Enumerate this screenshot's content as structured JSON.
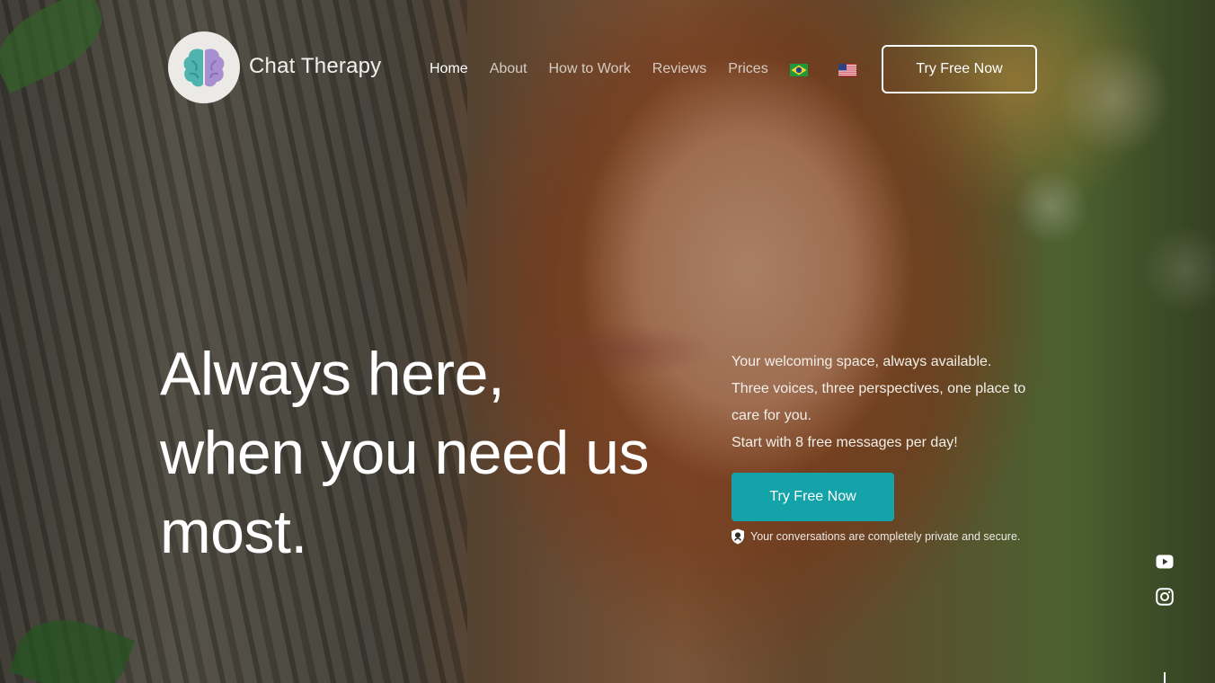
{
  "brand": {
    "name": "Chat Therapy",
    "logo_icon": "brain-icon"
  },
  "nav": {
    "items": [
      {
        "label": "Home",
        "active": true
      },
      {
        "label": "About",
        "active": false
      },
      {
        "label": "How to Work",
        "active": false
      },
      {
        "label": "Reviews",
        "active": false
      },
      {
        "label": "Prices",
        "active": false
      }
    ],
    "languages": [
      "brazil-flag-icon",
      "us-flag-icon"
    ],
    "cta_label": "Try Free Now"
  },
  "hero": {
    "headline_lines": [
      "Always here,",
      "when you need us",
      "most."
    ],
    "intro_lines": [
      "Your welcoming space, always available.",
      "Three voices, three perspectives, one place to care for you.",
      "Start with 8 free messages per day!"
    ],
    "cta_label": "Try Free Now",
    "privacy_note": "Your conversations are completely private and secure.",
    "privacy_icon": "shield-icon"
  },
  "social": [
    "youtube-icon",
    "instagram-icon"
  ],
  "colors": {
    "accent": "#13a3a8",
    "logo_bg": "#eceae6",
    "brain_teal": "#4fb3b0",
    "brain_purple": "#a88fd0"
  }
}
